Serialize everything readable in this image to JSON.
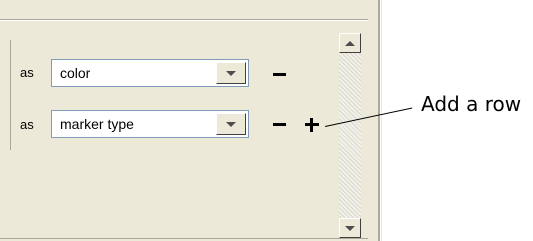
{
  "rows": [
    {
      "prefix": "as",
      "selected": "color",
      "actions": [
        "remove"
      ]
    },
    {
      "prefix": "as",
      "selected": "marker type",
      "actions": [
        "remove",
        "add"
      ]
    }
  ],
  "icons": {
    "remove": "minus-icon",
    "add": "plus-icon",
    "dropdown": "chevron-down-icon",
    "scroll_up": "scroll-up-arrow-icon",
    "scroll_down": "scroll-down-arrow-icon"
  },
  "annotation": {
    "text": "Add a row"
  },
  "colors": {
    "panel_bg": "#ece9d8",
    "border": "#aca899",
    "combo_border": "#7f9db9",
    "text": "#000000"
  }
}
